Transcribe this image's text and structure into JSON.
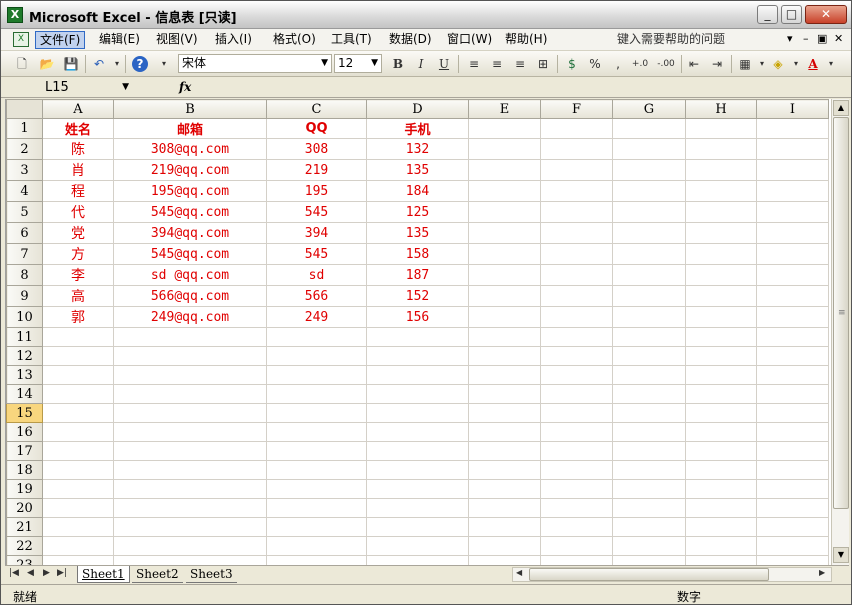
{
  "window": {
    "title": "Microsoft Excel - 信息表 [只读]",
    "app_icon": "excel-icon"
  },
  "menu": {
    "items": [
      "文件(F)",
      "编辑(E)",
      "视图(V)",
      "插入(I)",
      "格式(O)",
      "工具(T)",
      "数据(D)",
      "窗口(W)",
      "帮助(H)"
    ],
    "active_index": 0,
    "help_placeholder": "键入需要帮助的问题"
  },
  "toolbar": {
    "font_name": "宋体",
    "font_size": "12",
    "percent": "%",
    "comma": ",",
    "dec_increase": "+.0",
    "dec_decrease": "-.00",
    "bold": "B",
    "italic": "I",
    "underline": "U",
    "font_color_label": "A"
  },
  "formula_bar": {
    "name_box": "L15",
    "fx": "fx",
    "formula": ""
  },
  "grid": {
    "columns": [
      "A",
      "B",
      "C",
      "D",
      "E",
      "F",
      "G",
      "H",
      "I"
    ],
    "row_count": 24,
    "selected_row": 15,
    "headers": [
      "姓名",
      "邮箱",
      "QQ",
      "手机"
    ],
    "rows": [
      [
        "陈",
        "308@qq.com",
        "308",
        "132"
      ],
      [
        "肖",
        "219@qq.com",
        "219",
        "135"
      ],
      [
        "程",
        "195@qq.com",
        "195",
        "184"
      ],
      [
        "代",
        "545@qq.com",
        "545",
        "125"
      ],
      [
        "党",
        "394@qq.com",
        "394",
        "135"
      ],
      [
        "方",
        "545@qq.com",
        "545",
        "158"
      ],
      [
        "李",
        "sd @qq.com",
        "sd",
        "187"
      ],
      [
        "高",
        "566@qq.com",
        "566",
        "152"
      ],
      [
        "郭",
        "249@qq.com",
        "249",
        "156"
      ]
    ],
    "text_color": "#e00000"
  },
  "sheets": {
    "tabs": [
      "Sheet1",
      "Sheet2",
      "Sheet3"
    ],
    "active": "Sheet1"
  },
  "status": {
    "left": "就绪",
    "mode": "数字"
  }
}
